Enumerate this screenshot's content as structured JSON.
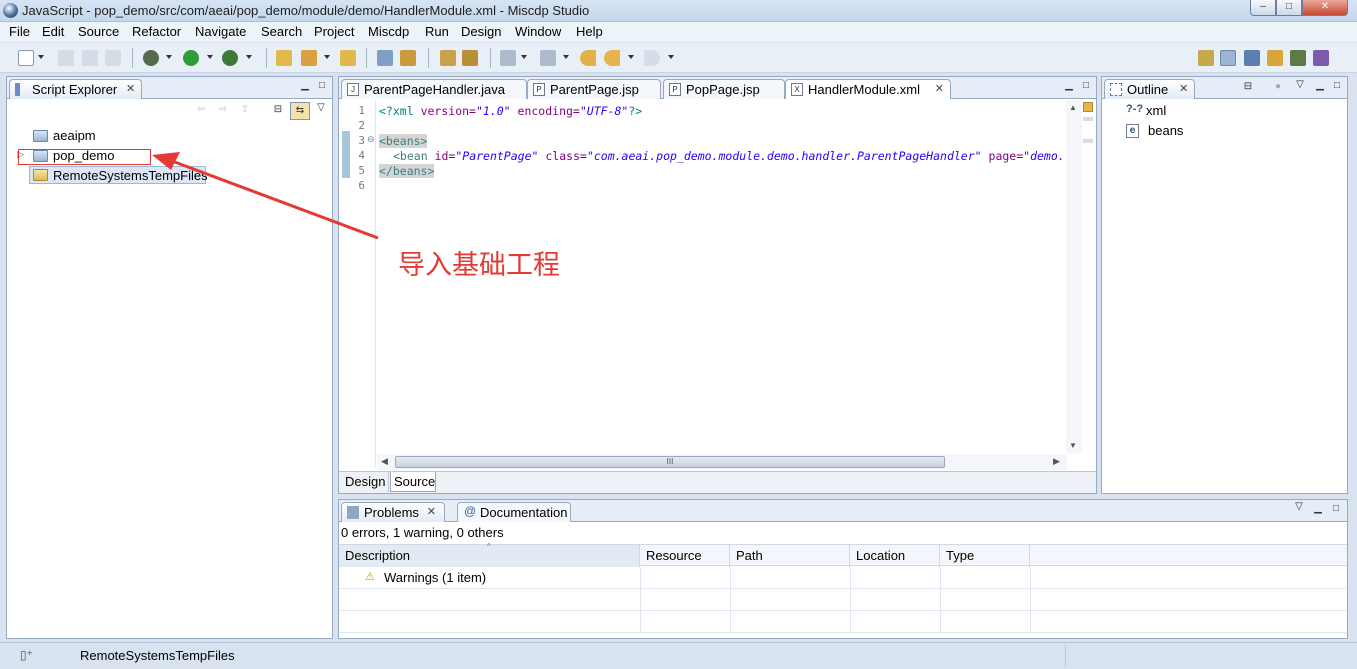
{
  "window": {
    "title": "JavaScript - pop_demo/src/com/aeai/pop_demo/module/demo/HandlerModule.xml - Miscdp Studio",
    "minimize_label": "–",
    "maximize_label": "□",
    "close_label": "✕"
  },
  "menubar": {
    "items": [
      "File",
      "Edit",
      "Source",
      "Refactor",
      "Navigate",
      "Search",
      "Project",
      "Miscdp",
      "Run",
      "Design",
      "Window",
      "Help"
    ]
  },
  "script_explorer": {
    "tab_label": "Script Explorer",
    "items": [
      {
        "label": "aeaipm",
        "icon": "project-icon"
      },
      {
        "label": "pop_demo",
        "icon": "project-icon"
      },
      {
        "label": "RemoteSystemsTempFiles",
        "icon": "folder-icon"
      }
    ]
  },
  "editor": {
    "tabs": [
      {
        "label": "ParentPageHandler.java",
        "icon": "J"
      },
      {
        "label": "ParentPage.jsp",
        "icon": "P"
      },
      {
        "label": "PopPage.jsp",
        "icon": "P"
      },
      {
        "label": "HandlerModule.xml",
        "icon": "X"
      }
    ],
    "active_tab": "HandlerModule.xml",
    "line_numbers": [
      "1",
      "2",
      "3",
      "4",
      "5",
      "6"
    ],
    "code": {
      "l1_open": "<?",
      "l1_tag": "xml",
      "l1_attr1": "version=",
      "l1_val1": "\"1.0\"",
      "l1_attr2": "encoding=",
      "l1_val2": "\"UTF-8\"",
      "l1_close": "?>",
      "l3": "<beans>",
      "l4_tag": "<bean",
      "l4_id_attr": "id=",
      "l4_id_val": "\"ParentPage\"",
      "l4_class_attr": "class=",
      "l4_class_val": "\"com.aeai.pop_demo.module.demo.handler.ParentPageHandler\"",
      "l4_page_attr": "page=",
      "l4_page_val": "\"demo.",
      "l5": "</beans>"
    },
    "bottom_tabs": [
      "Design",
      "Source"
    ],
    "scroll_grip": "III"
  },
  "outline": {
    "tab_label": "Outline",
    "items": [
      {
        "label": "xml",
        "icon_text": "?-?"
      },
      {
        "label": "beans",
        "icon_text": "e"
      }
    ]
  },
  "annotation": {
    "text": "导入基础工程",
    "color": "#e53935"
  },
  "problems": {
    "tabs": [
      "Problems",
      "Documentation"
    ],
    "summary": "0 errors, 1 warning, 0 others",
    "columns": [
      "Description",
      "Resource",
      "Path",
      "Location",
      "Type"
    ],
    "rows": [
      {
        "description": "Warnings (1 item)"
      }
    ]
  },
  "statusbar": {
    "text": "RemoteSystemsTempFiles"
  }
}
